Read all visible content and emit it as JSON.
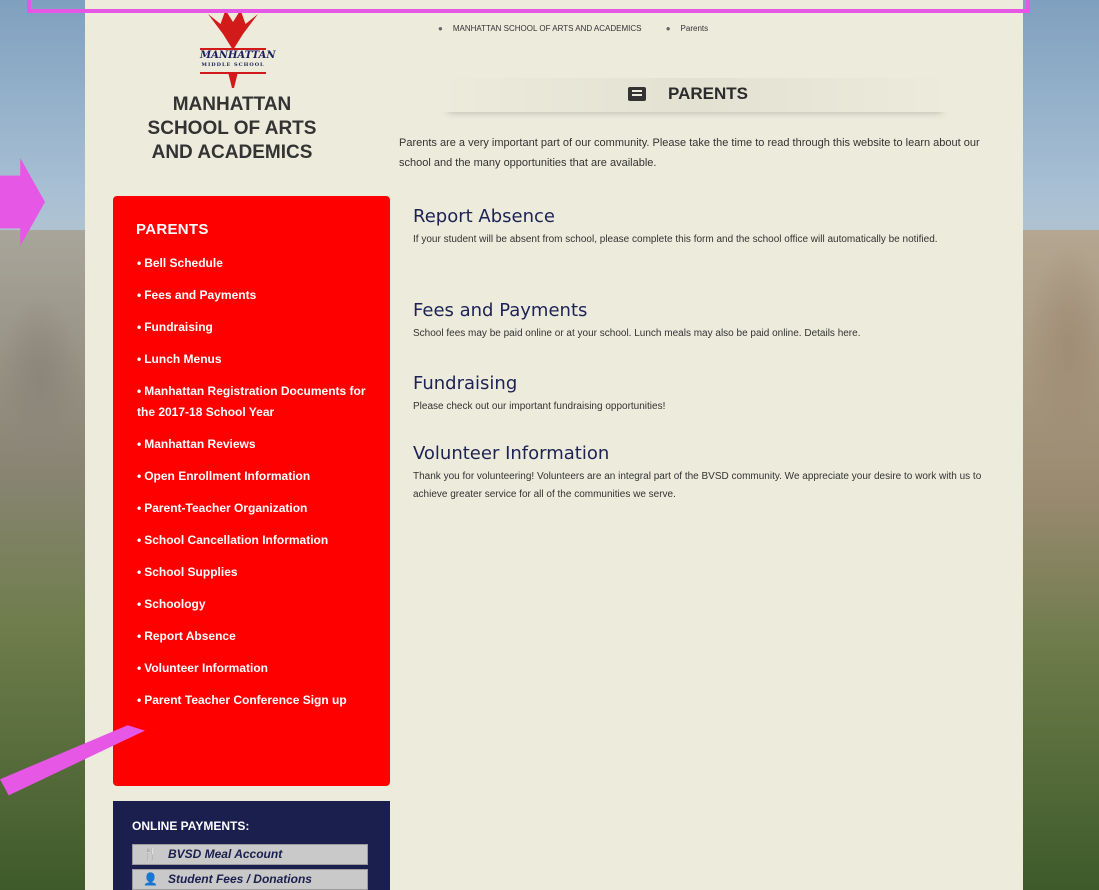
{
  "logo": {
    "band_text": "MANHATTAN",
    "band_subtext": "MIDDLE SCHOOL"
  },
  "school": {
    "name": "MANHATTAN SCHOOL OF ARTS AND ACADEMICS"
  },
  "breadcrumb": {
    "items": [
      "MANHATTAN SCHOOL OF ARTS AND ACADEMICS",
      "Parents"
    ]
  },
  "page": {
    "title": "PARENTS",
    "intro": "Parents are a very important part of our community. Please take the time to read through this website to learn about our school and the many opportunities that are available."
  },
  "sections": [
    {
      "heading": "Report Absence",
      "body": "If your student will be absent from school, please complete this form and the school office will automatically be notified."
    },
    {
      "heading": "Fees and Payments",
      "body": "School fees may be paid online or at your school. Lunch meals may also be paid online. Details here."
    },
    {
      "heading": "Fundraising",
      "body": "Please check out our important fundraising opportunities!"
    },
    {
      "heading": "Volunteer Information",
      "body": "Thank you for volunteering! Volunteers are an integral part of the BVSD community. We appreciate your desire to work with us to achieve greater service for all of the communities we serve."
    }
  ],
  "sidebar": {
    "heading": "PARENTS",
    "items": [
      {
        "label": "Bell Schedule"
      },
      {
        "label": "Fees and Payments"
      },
      {
        "label": "Fundraising"
      },
      {
        "label": "Lunch Menus"
      },
      {
        "label": "Manhattan Registration Documents for the 2017-18 School Year"
      },
      {
        "label": "Manhattan Reviews"
      },
      {
        "label": "Open Enrollment Information"
      },
      {
        "label": "Parent-Teacher Organization"
      },
      {
        "label": "School Cancellation Information"
      },
      {
        "label": "School Supplies"
      },
      {
        "label": "Schoology"
      },
      {
        "label": "Report Absence"
      },
      {
        "label": "Volunteer Information"
      },
      {
        "label": "Parent Teacher Conference Sign up"
      }
    ]
  },
  "payments": {
    "heading": "ONLINE PAYMENTS:",
    "buttons": [
      {
        "label": "BVSD Meal Account",
        "icon": "utensils-icon"
      },
      {
        "label": "Student Fees / Donations",
        "icon": "student-icon"
      }
    ]
  },
  "colors": {
    "sidebar_bg": "#ff0000",
    "payments_bg": "#1a1f4e",
    "panel_bg": "#ecebdc",
    "annotation": "#e657e6",
    "heading": "#1d2255"
  }
}
